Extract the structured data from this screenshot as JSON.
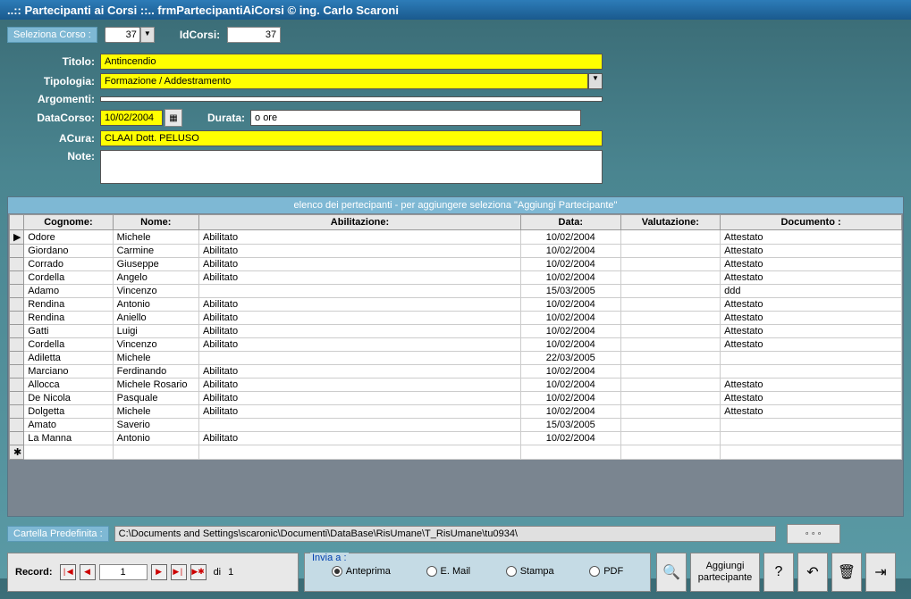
{
  "window": {
    "title": "..:: Partecipanti ai Corsi ::..    frmPartecipantiAiCorsi © ing. Carlo Scaroni"
  },
  "top": {
    "seleziona_label": "Seleziona Corso :",
    "seleziona_value": "37",
    "idcorsi_label": "IdCorsi:",
    "idcorsi_value": "37"
  },
  "form": {
    "titolo_label": "Titolo:",
    "titolo_value": "Antincendio",
    "tipologia_label": "Tipologia:",
    "tipologia_value": "Formazione / Addestramento",
    "argomenti_label": "Argomenti:",
    "argomenti_value": "",
    "datacorso_label": "DataCorso:",
    "datacorso_value": "10/02/2004",
    "durata_label": "Durata:",
    "durata_value": "o ore",
    "acura_label": "ACura:",
    "acura_value": "CLAAI   Dott. PELUSO",
    "note_label": "Note:",
    "note_value": ""
  },
  "grid": {
    "title": "elenco dei pertecipanti - per aggiungere seleziona \"Aggiungi Partecipante\"",
    "headers": [
      "Cognome:",
      "Nome:",
      "Abilitazione:",
      "Data:",
      "Valutazione:",
      "Documento :"
    ],
    "rows": [
      {
        "sel": "▶",
        "cognome": "Odore",
        "nome": "Michele",
        "abil": "Abilitato",
        "data": "10/02/2004",
        "val": "",
        "doc": "Attestato"
      },
      {
        "sel": "",
        "cognome": "Giordano",
        "nome": "Carmine",
        "abil": "Abilitato",
        "data": "10/02/2004",
        "val": "",
        "doc": "Attestato"
      },
      {
        "sel": "",
        "cognome": "Corrado",
        "nome": "Giuseppe",
        "abil": "Abilitato",
        "data": "10/02/2004",
        "val": "",
        "doc": "Attestato"
      },
      {
        "sel": "",
        "cognome": "Cordella",
        "nome": "Angelo",
        "abil": "Abilitato",
        "data": "10/02/2004",
        "val": "",
        "doc": "Attestato"
      },
      {
        "sel": "",
        "cognome": "Adamo",
        "nome": "Vincenzo",
        "abil": "",
        "data": "15/03/2005",
        "val": "",
        "doc": "ddd"
      },
      {
        "sel": "",
        "cognome": "Rendina",
        "nome": "Antonio",
        "abil": "Abilitato",
        "data": "10/02/2004",
        "val": "",
        "doc": "Attestato"
      },
      {
        "sel": "",
        "cognome": "Rendina",
        "nome": "Aniello",
        "abil": "Abilitato",
        "data": "10/02/2004",
        "val": "",
        "doc": "Attestato"
      },
      {
        "sel": "",
        "cognome": "Gatti",
        "nome": "Luigi",
        "abil": "Abilitato",
        "data": "10/02/2004",
        "val": "",
        "doc": "Attestato"
      },
      {
        "sel": "",
        "cognome": "Cordella",
        "nome": "Vincenzo",
        "abil": "Abilitato",
        "data": "10/02/2004",
        "val": "",
        "doc": "Attestato"
      },
      {
        "sel": "",
        "cognome": "Adiletta",
        "nome": "Michele",
        "abil": "",
        "data": "22/03/2005",
        "val": "",
        "doc": ""
      },
      {
        "sel": "",
        "cognome": "Marciano",
        "nome": "Ferdinando",
        "abil": "Abilitato",
        "data": "10/02/2004",
        "val": "",
        "doc": ""
      },
      {
        "sel": "",
        "cognome": "Allocca",
        "nome": "Michele Rosario",
        "abil": "Abilitato",
        "data": "10/02/2004",
        "val": "",
        "doc": "Attestato"
      },
      {
        "sel": "",
        "cognome": "De Nicola",
        "nome": "Pasquale",
        "abil": "Abilitato",
        "data": "10/02/2004",
        "val": "",
        "doc": "Attestato"
      },
      {
        "sel": "",
        "cognome": "Dolgetta",
        "nome": "Michele",
        "abil": "Abilitato",
        "data": "10/02/2004",
        "val": "",
        "doc": "Attestato"
      },
      {
        "sel": "",
        "cognome": "Amato",
        "nome": "Saverio",
        "abil": "",
        "data": "15/03/2005",
        "val": "",
        "doc": ""
      },
      {
        "sel": "",
        "cognome": "La Manna",
        "nome": "Antonio",
        "abil": "Abilitato",
        "data": "10/02/2004",
        "val": "",
        "doc": ""
      }
    ],
    "new_row_marker": "✱"
  },
  "path": {
    "label": "Cartella Predefinita :",
    "value": "C:\\Documents and Settings\\scaronic\\Documenti\\DataBase\\RisUmane\\T_RisUmane\\tu0934\\",
    "dots": "◦ ◦ ◦"
  },
  "record_nav": {
    "label": "Record:",
    "first": "|◀",
    "prev": "◀",
    "value": "1",
    "next": "▶",
    "last": "▶|",
    "new": "▶✱",
    "of_label": "di",
    "total": "1"
  },
  "invia": {
    "legend": "Invia a :",
    "opts": [
      {
        "label": "Anteprima",
        "checked": true
      },
      {
        "label": "E. Mail",
        "checked": false
      },
      {
        "label": "Stampa",
        "checked": false
      },
      {
        "label": "PDF",
        "checked": false
      }
    ]
  },
  "actions": {
    "preview_icon": "🔍",
    "add_label": "Aggiungi partecipante",
    "help_icon": "?",
    "undo_icon": "↶",
    "delete_icon": "🗑",
    "exit_icon": "⇥"
  }
}
